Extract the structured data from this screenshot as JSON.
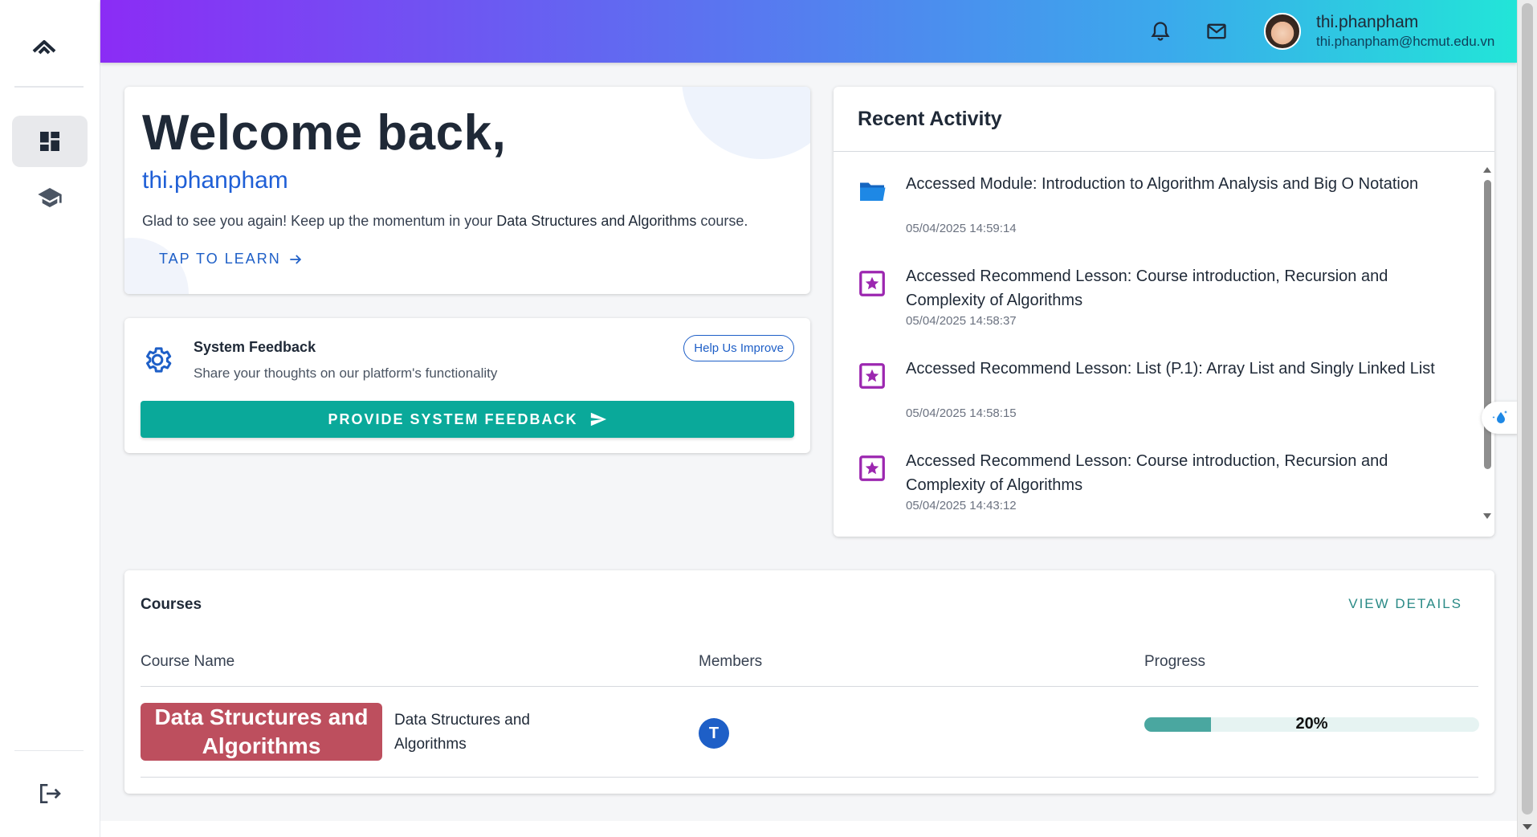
{
  "header": {
    "user_name": "thi.phanpham",
    "user_email": "thi.phanpham@hcmut.edu.vn",
    "gradient": [
      "#8b2cf5",
      "#6366f1",
      "#3ba9ec",
      "#22e5d8"
    ]
  },
  "sidebar": {
    "items": [
      {
        "icon": "dashboard-icon",
        "active": true
      },
      {
        "icon": "graduation-cap-icon",
        "active": false
      }
    ],
    "logout_icon": "logout-icon"
  },
  "welcome": {
    "heading": "Welcome back,",
    "username": "thi.phanpham",
    "message_prefix": "Glad to see you again! Keep up the momentum in your ",
    "course": "Data Structures and Algorithms",
    "message_suffix": " course.",
    "cta": "TAP TO LEARN"
  },
  "feedback": {
    "title": "System Feedback",
    "subtitle": "Share your thoughts on our platform's functionality",
    "help_button": "Help Us Improve",
    "provide_button": "PROVIDE SYSTEM FEEDBACK"
  },
  "activity": {
    "title": "Recent Activity",
    "items": [
      {
        "icon": "folder-icon",
        "text": "Accessed Module: Introduction to Algorithm Analysis and Big O Notation",
        "time": "05/04/2025 14:59:14"
      },
      {
        "icon": "star-box-icon",
        "text": "Accessed Recommend Lesson: Course introduction, Recursion and Complexity of Algorithms",
        "time": "05/04/2025 14:58:37"
      },
      {
        "icon": "star-box-icon",
        "text": "Accessed Recommend Lesson: List (P.1): Array List and Singly Linked List",
        "time": "05/04/2025 14:58:15"
      },
      {
        "icon": "star-box-icon",
        "text": "Accessed Recommend Lesson: Course introduction, Recursion and Complexity of Algorithms",
        "time": "05/04/2025 14:43:12"
      }
    ]
  },
  "courses": {
    "title": "Courses",
    "view_details": "VIEW DETAILS",
    "columns": [
      "Course Name",
      "Members",
      "Progress"
    ],
    "rows": [
      {
        "thumbnail_text": "Data Structures and Algorithms",
        "name": "Data Structures and Algorithms",
        "member_initial": "T",
        "progress_label": "20%",
        "progress": 0.2
      }
    ]
  },
  "colors": {
    "accent_blue": "#1e5fc7",
    "teal_button": "#0aa99a",
    "progress_fill": "#4aa7a0",
    "course_thumb": "#bd4f5e",
    "activity_icon_purple": "#9c27b0"
  }
}
